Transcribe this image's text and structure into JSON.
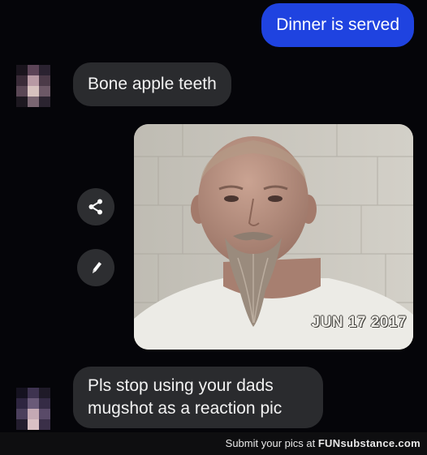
{
  "messages": {
    "outgoing_1": "Dinner is served",
    "incoming_1": "Bone apple teeth",
    "incoming_2_line1": "Pls stop using your dads",
    "incoming_2_line2": "mugshot as a reaction pic"
  },
  "photo": {
    "date_stamp": "JUN 17 2017"
  },
  "actions": {
    "share_icon": "share-icon",
    "edit_icon": "pencil-icon"
  },
  "footer": {
    "prefix": "Submit your pics at ",
    "brand_part1": "FUN",
    "brand_part2": "substance",
    "brand_part3": ".com"
  },
  "colors": {
    "background": "#050509",
    "outgoing_bubble": "#1f43e0",
    "incoming_bubble": "#2a2b2e"
  }
}
